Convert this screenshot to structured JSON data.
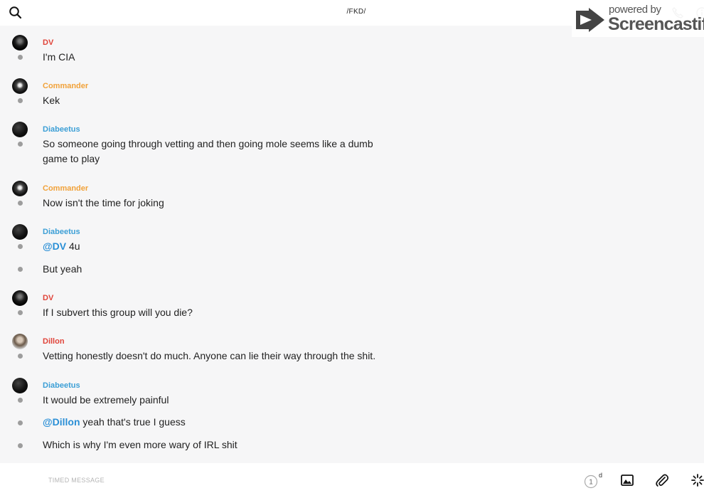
{
  "header": {
    "title": "/FKD/",
    "search_icon": "search-icon",
    "call_icon": "phone-icon",
    "info_icon": "info-icon"
  },
  "watermark": {
    "line1": "powered by",
    "line2": "Screencastify"
  },
  "colors": {
    "dv": "#e0443a",
    "commander": "#f1a23a",
    "diabeetus": "#3c9fd6",
    "dillon": "#e0443a",
    "mention": "#2a8fd6"
  },
  "messages": [
    {
      "sender": "DV",
      "lines": [
        "I'm CIA"
      ]
    },
    {
      "sender": "Commander",
      "lines": [
        "Kek"
      ]
    },
    {
      "sender": "Diabeetus",
      "lines": [
        "So someone going through vetting and then going mole seems like a dumb game to play"
      ]
    },
    {
      "sender": "Commander",
      "lines": [
        "Now isn't the time for joking"
      ]
    },
    {
      "sender": "Diabeetus",
      "mention_1": "@DV",
      "rest_1": " 4u",
      "lines": [
        "But yeah"
      ]
    },
    {
      "sender": "DV",
      "lines": [
        "If I subvert this group will you die?"
      ]
    },
    {
      "sender": "Dillon",
      "lines": [
        "Vetting honestly doesn't do much. Anyone can lie their way through the shit."
      ]
    },
    {
      "sender": "Diabeetus",
      "lines": [
        "It would be extremely painful",
        "Which is why I'm even more wary of IRL shit"
      ],
      "mention_2": "@Dillon",
      "rest_2": " yeah that's true I guess"
    }
  ],
  "composer": {
    "placeholder": "TIMED MESSAGE",
    "timer_value": "1",
    "timer_unit": "d"
  }
}
